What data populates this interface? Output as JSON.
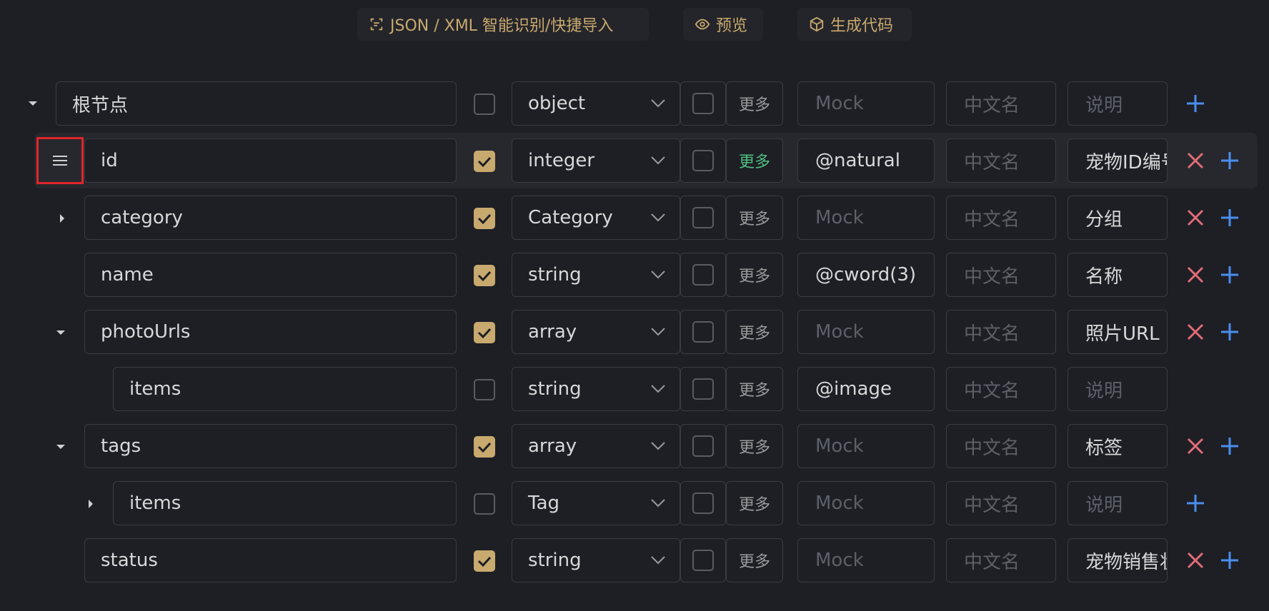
{
  "toolbar": {
    "import_label": "JSON / XML 智能识别/快捷导入",
    "preview_label": "预览",
    "generate_label": "生成代码"
  },
  "root": {
    "name": "根节点",
    "type": "object",
    "more": "更多",
    "mock_placeholder": "Mock",
    "cn_placeholder": "中文名",
    "desc_placeholder": "说明"
  },
  "rows": [
    {
      "name": "id",
      "type": "integer",
      "more": "更多",
      "mock": "@natural",
      "cn": "中文名",
      "desc": "宠物ID编号"
    },
    {
      "name": "category",
      "type": "Category",
      "more": "更多",
      "mock": "Mock",
      "cn": "中文名",
      "desc": "分组"
    },
    {
      "name": "name",
      "type": "string",
      "more": "更多",
      "mock": "@cword(3)",
      "cn": "中文名",
      "desc": "名称"
    },
    {
      "name": "photoUrls",
      "type": "array",
      "more": "更多",
      "mock": "Mock",
      "cn": "中文名",
      "desc": "照片URL"
    },
    {
      "name": "items",
      "type": "string",
      "more": "更多",
      "mock": "@image",
      "cn": "中文名",
      "desc": "说明"
    },
    {
      "name": "tags",
      "type": "array",
      "more": "更多",
      "mock": "Mock",
      "cn": "中文名",
      "desc": "标签"
    },
    {
      "name": "items",
      "type": "Tag",
      "more": "更多",
      "mock": "Mock",
      "cn": "中文名",
      "desc": "说明"
    },
    {
      "name": "status",
      "type": "string",
      "more": "更多",
      "mock": "Mock",
      "cn": "中文名",
      "desc": "宠物销售状态"
    }
  ],
  "colors": {
    "accent": "#c8a96e",
    "delete": "#e06c75",
    "add": "#4a8ef0",
    "more_active": "#4fbf7f"
  }
}
